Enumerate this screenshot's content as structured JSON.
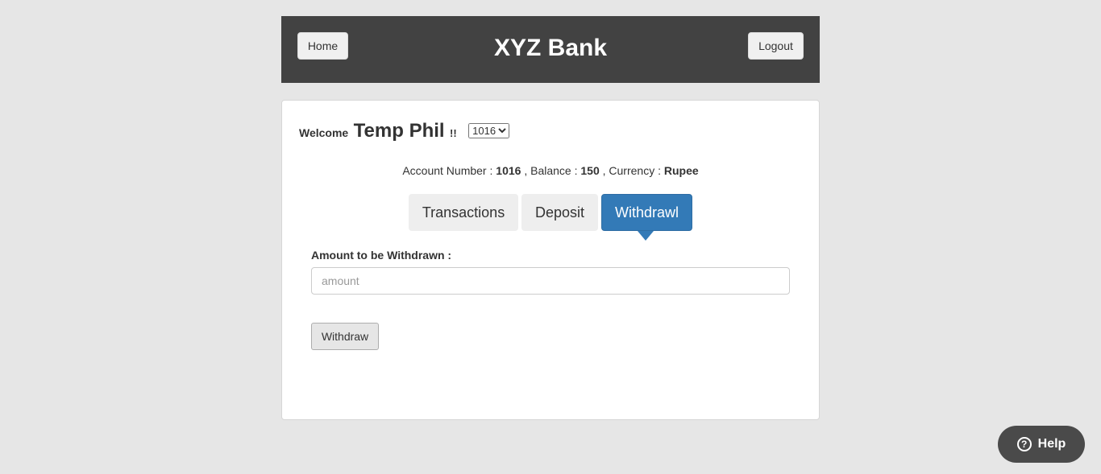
{
  "header": {
    "home_label": "Home",
    "title": "XYZ Bank",
    "logout_label": "Logout"
  },
  "welcome": {
    "label": "Welcome",
    "name": "Temp Phil",
    "suffix": "!!",
    "account_select": {
      "selected": "1016",
      "options": [
        "1016"
      ]
    }
  },
  "account_info": {
    "number_label": "Account Number :",
    "number": "1016",
    "balance_label": ", Balance :",
    "balance": "150",
    "currency_label": ", Currency :",
    "currency": "Rupee"
  },
  "tabs": [
    {
      "label": "Transactions",
      "active": false
    },
    {
      "label": "Deposit",
      "active": false
    },
    {
      "label": "Withdrawl",
      "active": true
    }
  ],
  "withdraw_form": {
    "amount_label": "Amount to be Withdrawn :",
    "amount_value": "",
    "amount_placeholder": "amount",
    "submit_label": "Withdraw"
  },
  "help_widget": {
    "icon": "question-circle-icon",
    "label": "Help"
  },
  "colors": {
    "header_bg": "#424242",
    "active_tab": "#337ab7",
    "page_bg": "#e6e6e6"
  }
}
